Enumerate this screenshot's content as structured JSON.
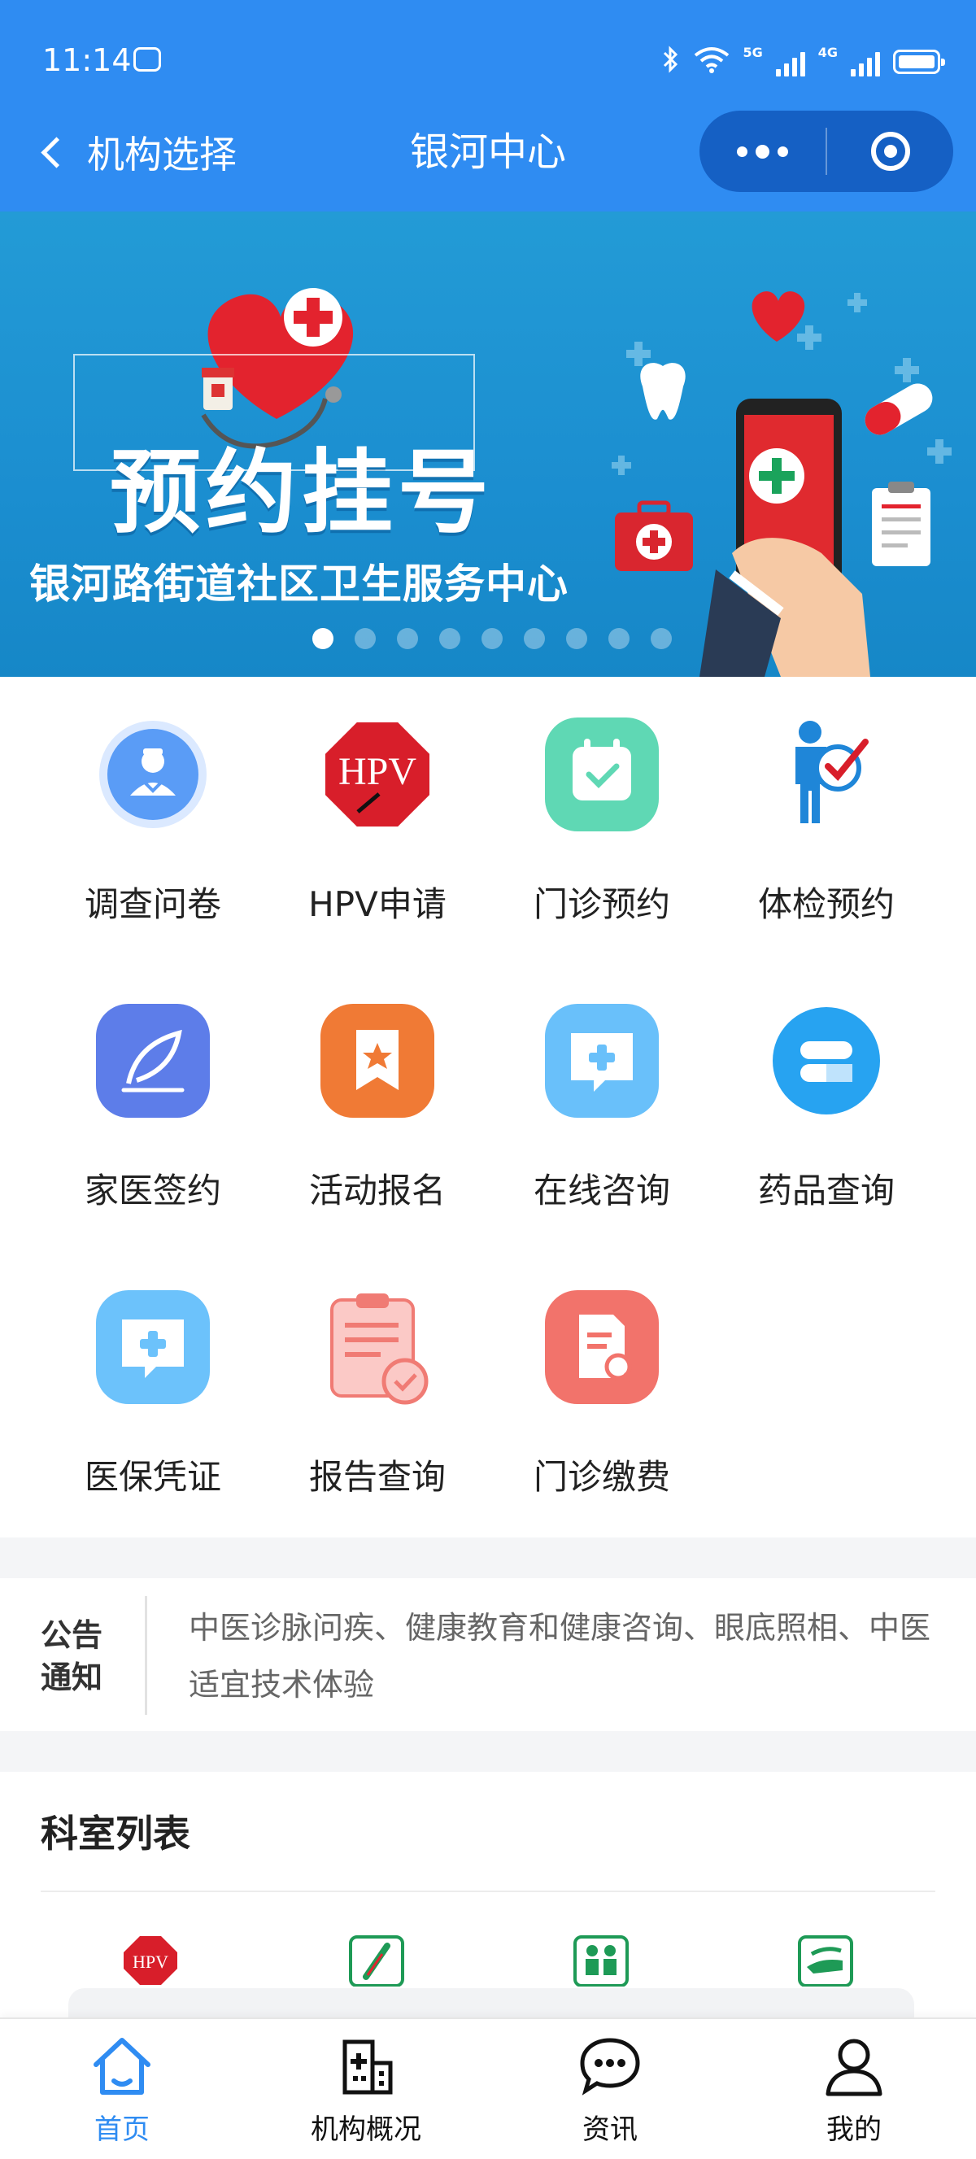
{
  "status_bar": {
    "time": "11:14",
    "network_5g": "5G",
    "network_4g": "4G"
  },
  "nav": {
    "back_label": "机构选择",
    "title": "银河中心"
  },
  "banner": {
    "title": "预约挂号",
    "subtitle": "银河路街道社区卫生服务中心",
    "slide_count": 9,
    "active_slide": 1
  },
  "features": [
    {
      "label": "调查问卷",
      "icon": "doctor-icon"
    },
    {
      "label": "HPV申请",
      "icon": "hpv-sign-icon",
      "icon_text": "HPV"
    },
    {
      "label": "门诊预约",
      "icon": "calendar-check-icon"
    },
    {
      "label": "体检预约",
      "icon": "person-check-icon"
    },
    {
      "label": "家医签约",
      "icon": "feather-icon"
    },
    {
      "label": "活动报名",
      "icon": "bookmark-star-icon"
    },
    {
      "label": "在线咨询",
      "icon": "chat-plus-icon"
    },
    {
      "label": "药品查询",
      "icon": "pill-icon"
    },
    {
      "label": "医保凭证",
      "icon": "chat-plus-icon"
    },
    {
      "label": "报告查询",
      "icon": "clipboard-check-icon"
    },
    {
      "label": "门诊缴费",
      "icon": "document-search-icon"
    }
  ],
  "notice": {
    "tag_line1": "公告",
    "tag_line2": "通知",
    "text": "中医诊脉问疾、健康教育和健康咨询、眼底照相、中医适宜技术体验"
  },
  "departments": {
    "title": "科室列表",
    "icons": [
      "hpv-sign-icon",
      "thermometer-icon",
      "consultation-icon",
      "hand-care-icon"
    ],
    "hpv_icon_text": "HPV"
  },
  "tabbar": [
    {
      "label": "首页",
      "icon": "home-icon",
      "active": true
    },
    {
      "label": "机构概况",
      "icon": "building-icon",
      "active": false
    },
    {
      "label": "资讯",
      "icon": "chat-icon",
      "active": false
    },
    {
      "label": "我的",
      "icon": "user-icon",
      "active": false
    }
  ],
  "colors": {
    "primary": "#2f8cf2",
    "capsule": "#1560c4",
    "banner": "#1b8ed0",
    "hpv_red": "#d81e2a"
  }
}
